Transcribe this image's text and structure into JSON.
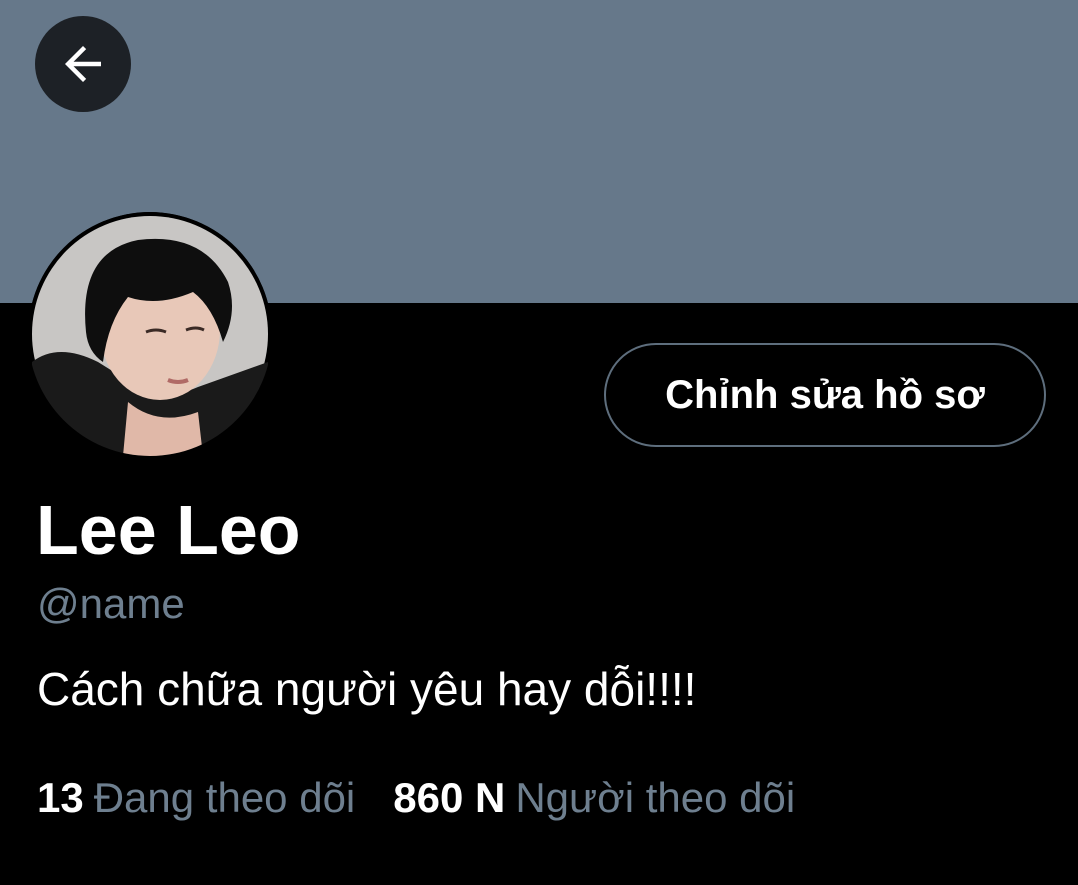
{
  "profile": {
    "display_name": "Lee Leo",
    "handle": "@name",
    "bio": "Cách chữa người yêu hay dỗi!!!!",
    "edit_button_label": "Chỉnh sửa hồ sơ",
    "banner_color": "#66788a",
    "avatar_icon": "avatar-photo"
  },
  "navigation": {
    "back_icon": "arrow-left-icon"
  },
  "stats": {
    "following_count": "13",
    "following_label": "Đang theo dõi",
    "followers_count": "860 N",
    "followers_label": "Người theo dõi"
  },
  "colors": {
    "background": "#000000",
    "secondary_text": "#6e7f8f",
    "button_border": "#5e6e7d"
  }
}
